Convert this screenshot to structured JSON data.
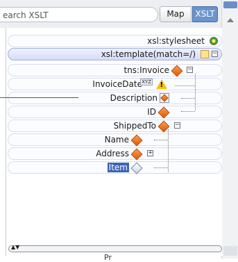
{
  "search": {
    "text": "earch XSLT"
  },
  "view_toggle": {
    "map_label": "Map",
    "xslt_label": "XSLT",
    "active": "XSLT"
  },
  "tree": {
    "items": [
      {
        "label": "xsl:stylesheet"
      },
      {
        "label": "xsl:template(match=/)"
      },
      {
        "label": "tns:Invoice"
      },
      {
        "label": "InvoiceDate"
      },
      {
        "label": "Description"
      },
      {
        "label": "ID"
      },
      {
        "label": "ShippedTo"
      },
      {
        "label": "Name"
      },
      {
        "label": "Address"
      },
      {
        "label": "Item"
      }
    ],
    "xyz_label": "XYZ",
    "warn_mark": "!",
    "collapse_minus": "−",
    "collapse_plus": "+"
  },
  "bottom": {
    "partial_row_text": "Pr"
  },
  "colors": {
    "accent": "#6b93cc",
    "selected_label": "#3b64b8",
    "row_border": "#d7dcec"
  }
}
